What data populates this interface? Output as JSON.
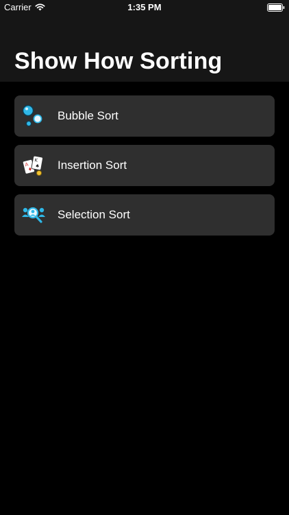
{
  "status_bar": {
    "carrier": "Carrier",
    "time": "1:35 PM",
    "icons": [
      "wifi-icon",
      "battery-icon"
    ]
  },
  "header": {
    "title": "Show How Sorting"
  },
  "list": {
    "items": [
      {
        "label": "Bubble Sort",
        "icon": "bubbles-icon"
      },
      {
        "label": "Insertion Sort",
        "icon": "playing-cards-icon"
      },
      {
        "label": "Selection Sort",
        "icon": "people-magnifier-icon"
      }
    ]
  },
  "colors": {
    "background": "#000000",
    "header_background": "#161616",
    "item_background": "#2f2f2f",
    "text": "#ffffff",
    "icon_accent": "#2fb8e8"
  }
}
